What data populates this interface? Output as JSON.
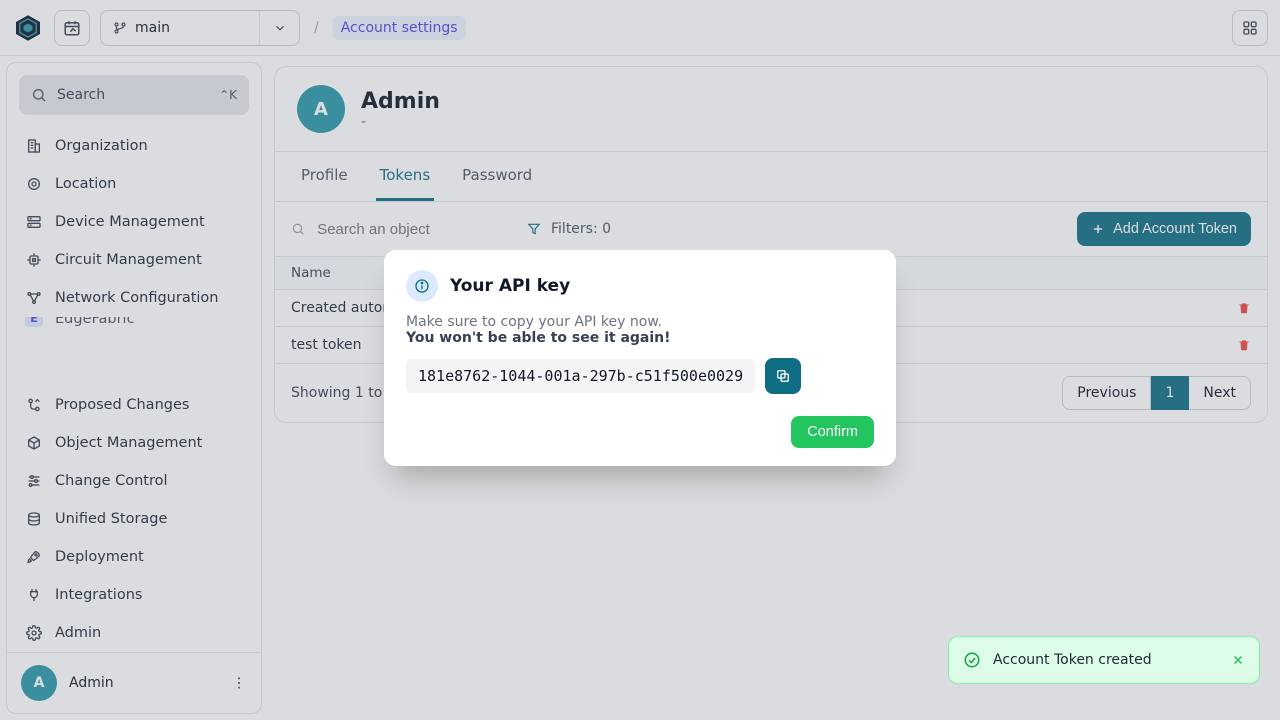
{
  "topbar": {
    "branch_label": "main",
    "breadcrumb_current": "Account settings"
  },
  "sidebar": {
    "search_label": "Search",
    "search_shortcut": "⌃K",
    "groups": {
      "top": [
        {
          "label": "Organization"
        },
        {
          "label": "Location"
        },
        {
          "label": "Device Management"
        },
        {
          "label": "Circuit Management"
        },
        {
          "label": "Network Configuration"
        }
      ],
      "cut_off": {
        "label": "EdgeFabric"
      },
      "bottom": [
        {
          "label": "Proposed Changes"
        },
        {
          "label": "Object Management"
        },
        {
          "label": "Change Control"
        },
        {
          "label": "Unified Storage"
        },
        {
          "label": "Deployment"
        },
        {
          "label": "Integrations"
        },
        {
          "label": "Admin"
        }
      ]
    },
    "user_name": "Admin",
    "user_avatar_letter": "A"
  },
  "page": {
    "title": "Admin",
    "subtitle": "-",
    "avatar_letter": "A",
    "tabs": [
      {
        "label": "Profile",
        "active": false
      },
      {
        "label": "Tokens",
        "active": true
      },
      {
        "label": "Password",
        "active": false
      }
    ],
    "search_placeholder": "Search an object",
    "filters_label": "Filters: 0",
    "add_button": "Add Account Token",
    "columns": [
      "Name"
    ],
    "rows": [
      {
        "name": "Created automatically"
      },
      {
        "name": "test token"
      }
    ],
    "footer_text": "Showing 1 to 2 of",
    "pager": {
      "prev": "Previous",
      "current": "1",
      "next": "Next"
    }
  },
  "modal": {
    "title": "Your API key",
    "line1": "Make sure to copy your API key now.",
    "line2": "You won't be able to see it again!",
    "api_key": "181e8762-1044-001a-297b-c51f500e0029",
    "confirm_label": "Confirm"
  },
  "toast": {
    "message": "Account Token created"
  }
}
